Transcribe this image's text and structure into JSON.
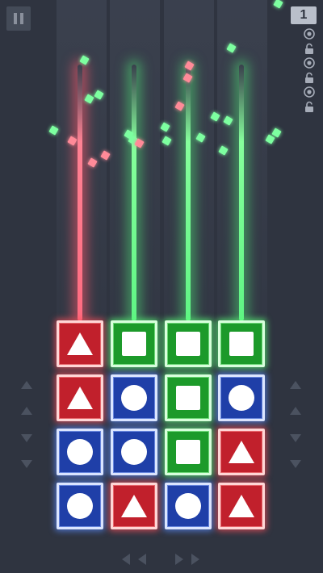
{
  "score": "1",
  "status_icons": [
    "target-icon",
    "unlock-icon",
    "target-icon",
    "unlock-icon",
    "target-icon",
    "unlock-icon"
  ],
  "columns": [
    {
      "beam": "red"
    },
    {
      "beam": "green"
    },
    {
      "beam": "green"
    },
    {
      "beam": "green"
    }
  ],
  "grid": [
    [
      {
        "color": "red",
        "shape": "triangle"
      },
      {
        "color": "green",
        "shape": "square"
      },
      {
        "color": "green",
        "shape": "square"
      },
      {
        "color": "green",
        "shape": "square"
      }
    ],
    [
      {
        "color": "red",
        "shape": "triangle"
      },
      {
        "color": "blue",
        "shape": "circle"
      },
      {
        "color": "green",
        "shape": "square"
      },
      {
        "color": "blue",
        "shape": "circle"
      }
    ],
    [
      {
        "color": "blue",
        "shape": "circle"
      },
      {
        "color": "blue",
        "shape": "circle"
      },
      {
        "color": "green",
        "shape": "square"
      },
      {
        "color": "red",
        "shape": "triangle"
      }
    ],
    [
      {
        "color": "blue",
        "shape": "circle"
      },
      {
        "color": "red",
        "shape": "triangle"
      },
      {
        "color": "blue",
        "shape": "circle"
      },
      {
        "color": "red",
        "shape": "triangle"
      }
    ]
  ],
  "colors": {
    "red": "#c1202c",
    "green": "#1c9a2a",
    "blue": "#1f3fa8",
    "spark_red": "#ff8a98",
    "spark_green": "#7dffa0"
  }
}
